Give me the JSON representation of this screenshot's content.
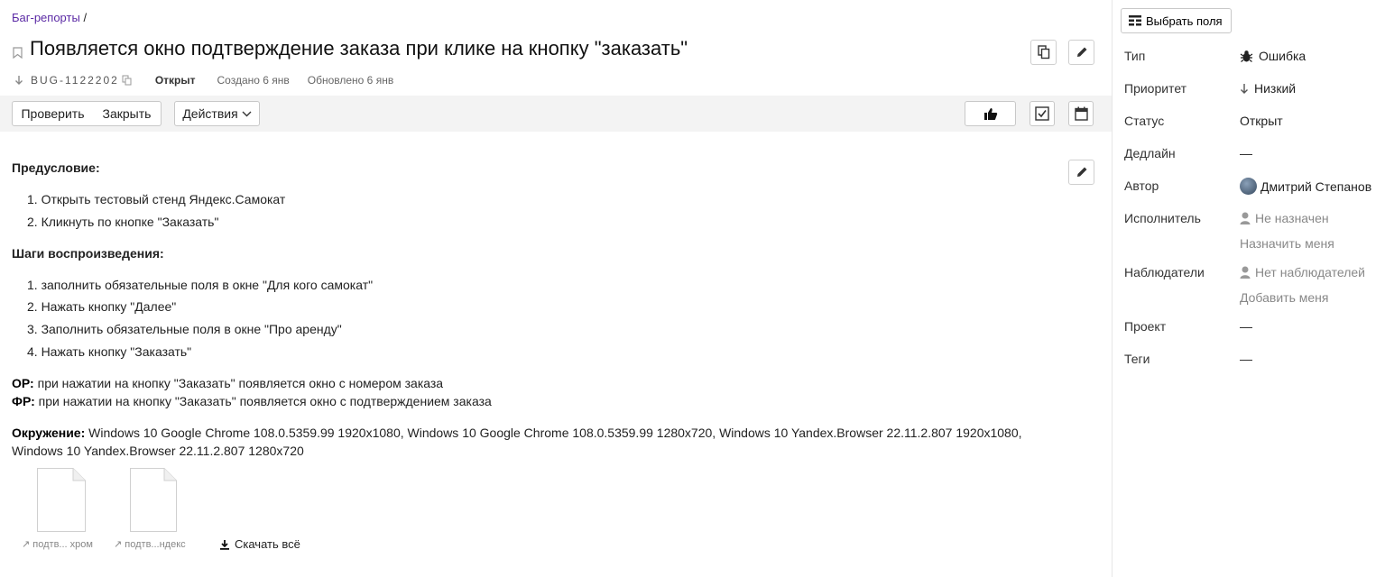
{
  "breadcrumb": {
    "link": "Баг-репорты",
    "separator": "/"
  },
  "issue": {
    "title": "Появляется окно подтверждение заказа при клике на кнопку \"заказать\"",
    "key": "BUG-1122202",
    "status": "Открыт",
    "created": "Создано 6 янв",
    "updated": "Обновлено 6 янв"
  },
  "toolbar": {
    "check_label": "Проверить",
    "close_label": "Закрыть",
    "actions_label": "Действия"
  },
  "description": {
    "precondition_title": "Предусловие:",
    "precondition_items": [
      "1. Открыть тестовый стенд Яндекс.Самокат",
      "2. Кликнуть по кнопке \"Заказать\""
    ],
    "steps_title": "Шаги воспроизведения:",
    "steps_items": [
      "1. заполнить обязательные поля в окне \"Для кого самокат\"",
      "2. Нажать кнопку \"Далее\"",
      "3. Заполнить обязательные поля в окне \"Про аренду\"",
      "4. Нажать кнопку \"Заказать\""
    ],
    "expected_label": "ОР:",
    "expected_text": " при нажатии на кнопку \"Заказать\" появляется окно с номером заказа",
    "actual_label": "ФР:",
    "actual_text": " при нажатии на кнопку \"Заказать\" появляется окно с подтверждением заказа",
    "env_label": "Окружение:",
    "env_line1": " Windows 10 Google Chrome 108.0.5359.99 1920x1080, Windows 10 Google Chrome 108.0.5359.99 1280x720, Windows 10 Yandex.Browser 22.11.2.807 1920x1080,",
    "env_line2": "Windows 10 Yandex.Browser 22.11.2.807 1280x720"
  },
  "attachments": [
    {
      "label": "подтв... хром"
    },
    {
      "label": "подтв...ндекс"
    }
  ],
  "download_all": "Скачать всё",
  "sidebar": {
    "choose_fields": "Выбрать поля",
    "type_label": "Тип",
    "type_value": "Ошибка",
    "priority_label": "Приоритет",
    "priority_value": "Низкий",
    "status_label": "Статус",
    "status_value": "Открыт",
    "deadline_label": "Дедлайн",
    "deadline_value": "—",
    "author_label": "Автор",
    "author_value": "Дмитрий Степанов",
    "assignee_label": "Исполнитель",
    "assignee_value": "Не назначен",
    "assign_me": "Назначить меня",
    "watchers_label": "Наблюдатели",
    "watchers_value": "Нет наблюдателей",
    "add_me": "Добавить меня",
    "project_label": "Проект",
    "project_value": "—",
    "tags_label": "Теги",
    "tags_value": "—"
  }
}
